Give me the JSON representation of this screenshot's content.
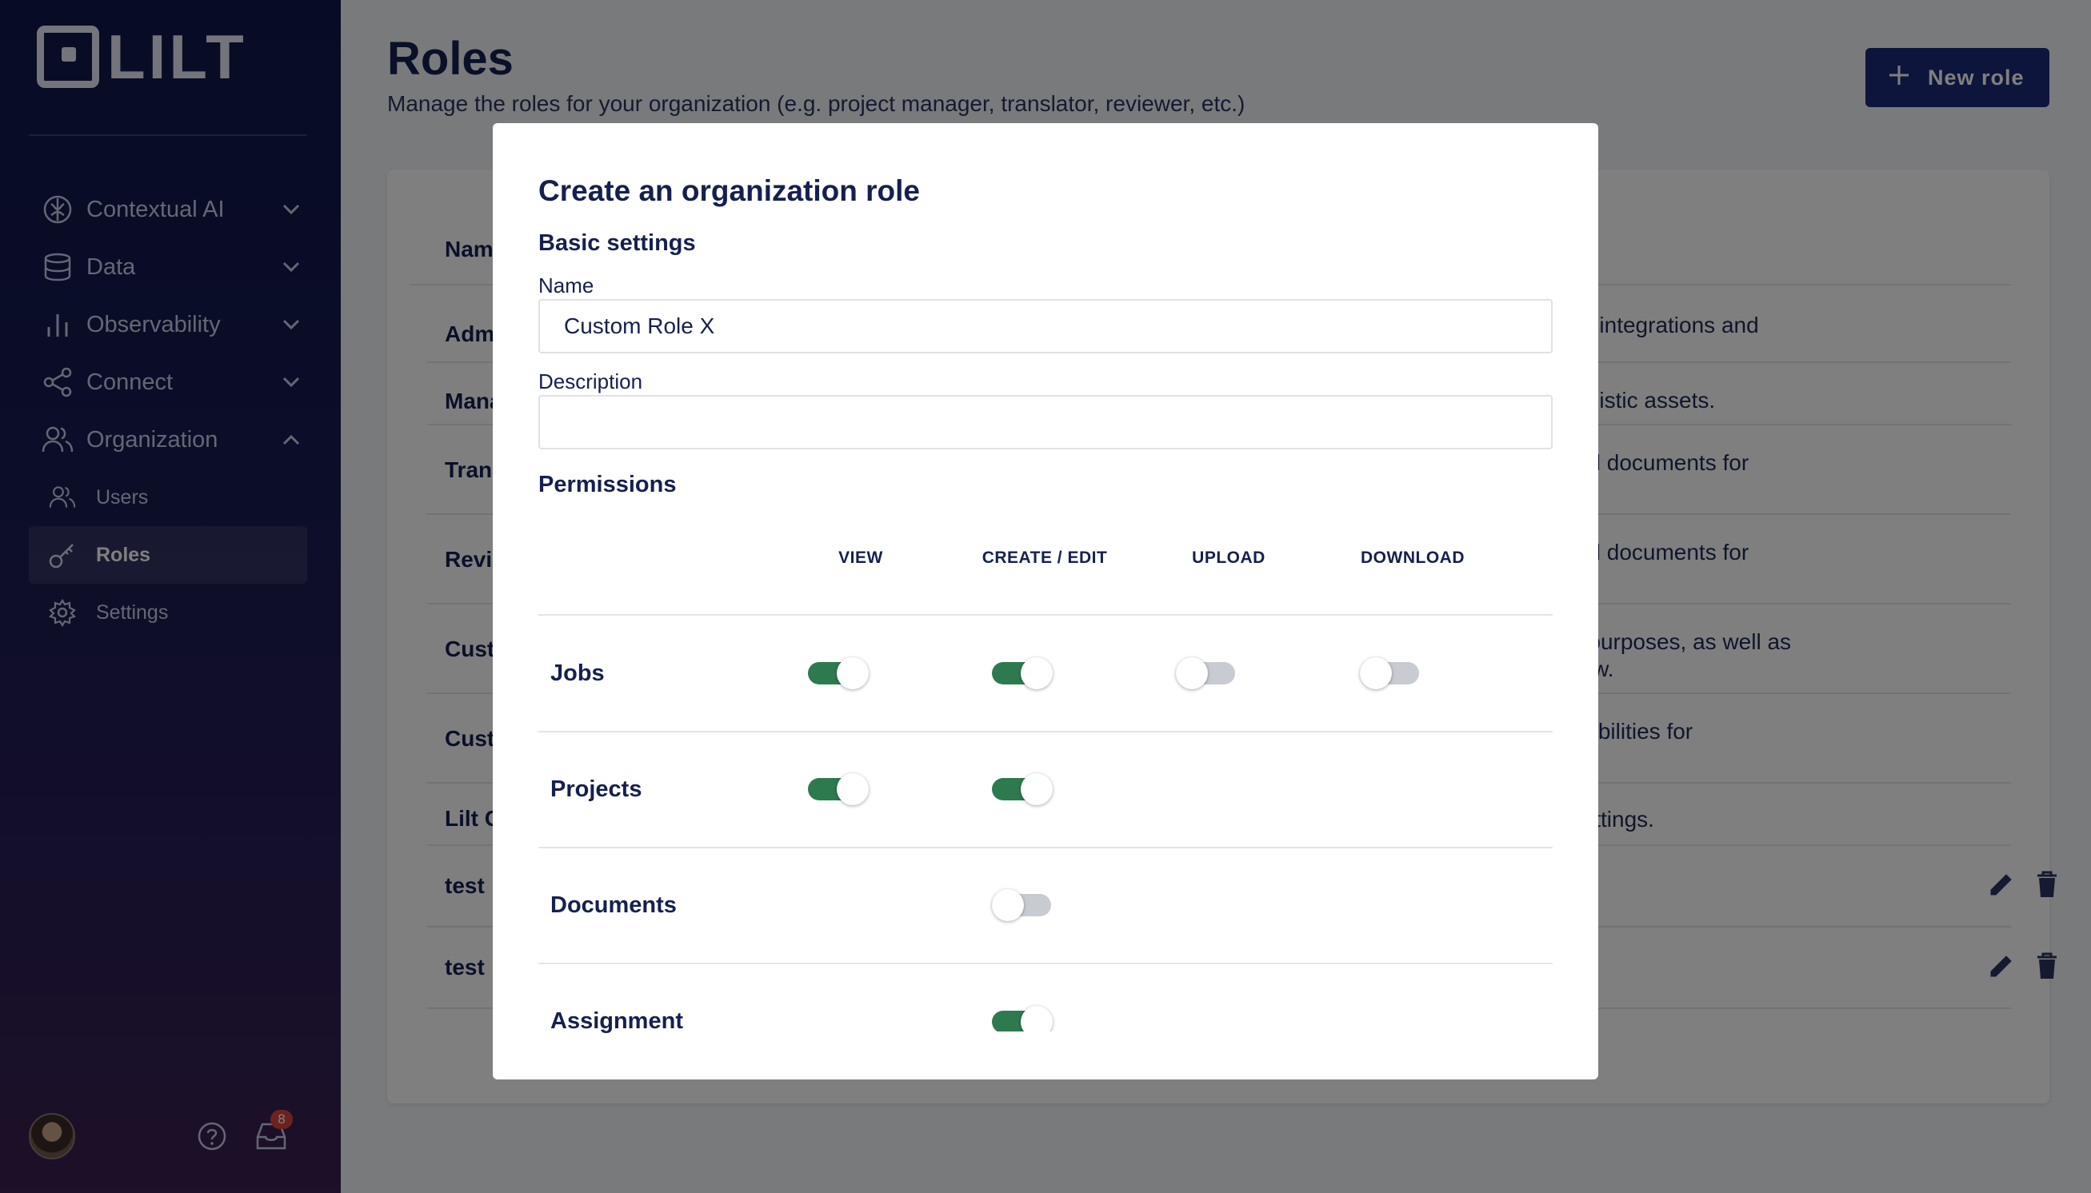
{
  "sidebar": {
    "logo_text": "LILT",
    "nav": [
      {
        "label": "Contextual AI",
        "icon": "brain-icon",
        "chevron": "chevron-down-icon"
      },
      {
        "label": "Data",
        "icon": "database-icon",
        "chevron": "chevron-down-icon"
      },
      {
        "label": "Observability",
        "icon": "bar-chart-icon",
        "chevron": "chevron-down-icon"
      },
      {
        "label": "Connect",
        "icon": "share-icon",
        "chevron": "chevron-down-icon"
      },
      {
        "label": "Organization",
        "icon": "users-icon",
        "chevron": "chevron-up-icon"
      }
    ],
    "sub": [
      {
        "label": "Users",
        "icon": "users-icon"
      },
      {
        "label": "Roles",
        "icon": "key-icon"
      },
      {
        "label": "Settings",
        "icon": "gear-icon"
      }
    ],
    "notifications_count": "8"
  },
  "page": {
    "title": "Roles",
    "subtitle": "Manage the roles for your organization (e.g. project manager, translator, reviewer, etc.)",
    "new_role_label": "New role",
    "table_header": "Nam",
    "rows": [
      {
        "name": "Adm",
        "desc": "n settings, integrations and"
      },
      {
        "name": "Mana",
        "desc": "y and linguistic assets."
      },
      {
        "name": "Tran",
        "desc": "rojects and documents for"
      },
      {
        "name": "Revi",
        "desc": "rojects and documents for"
      },
      {
        "name": "Cust",
        "desc": "or review purposes, as well as",
        "desc2": "ffline review."
      },
      {
        "name": "Cust",
        "desc": "ell as capabilities for"
      },
      {
        "name": "Lilt C",
        "desc": "e guide settings."
      },
      {
        "name": "test",
        "desc": ""
      },
      {
        "name": "test",
        "desc": ""
      }
    ]
  },
  "modal": {
    "title": "Create an organization role",
    "basic_settings": "Basic settings",
    "name_label": "Name",
    "name_value": "Custom Role X",
    "description_label": "Description",
    "description_value": "",
    "permissions_label": "Permissions",
    "columns": [
      "VIEW",
      "CREATE / EDIT",
      "UPLOAD",
      "DOWNLOAD"
    ],
    "permissions": [
      {
        "name": "Jobs",
        "view": true,
        "create_edit": true,
        "upload": false,
        "download": false
      },
      {
        "name": "Projects",
        "view": true,
        "create_edit": true
      },
      {
        "name": "Documents",
        "create_edit": false
      },
      {
        "name": "Assignment",
        "create_edit": true
      }
    ]
  },
  "colors": {
    "sidebar_bg": "#0f174a",
    "primary_button": "#1c2a78",
    "toggle_on": "#2e7a4f",
    "toggle_off": "#c9cbd3",
    "badge": "#d9473f"
  }
}
